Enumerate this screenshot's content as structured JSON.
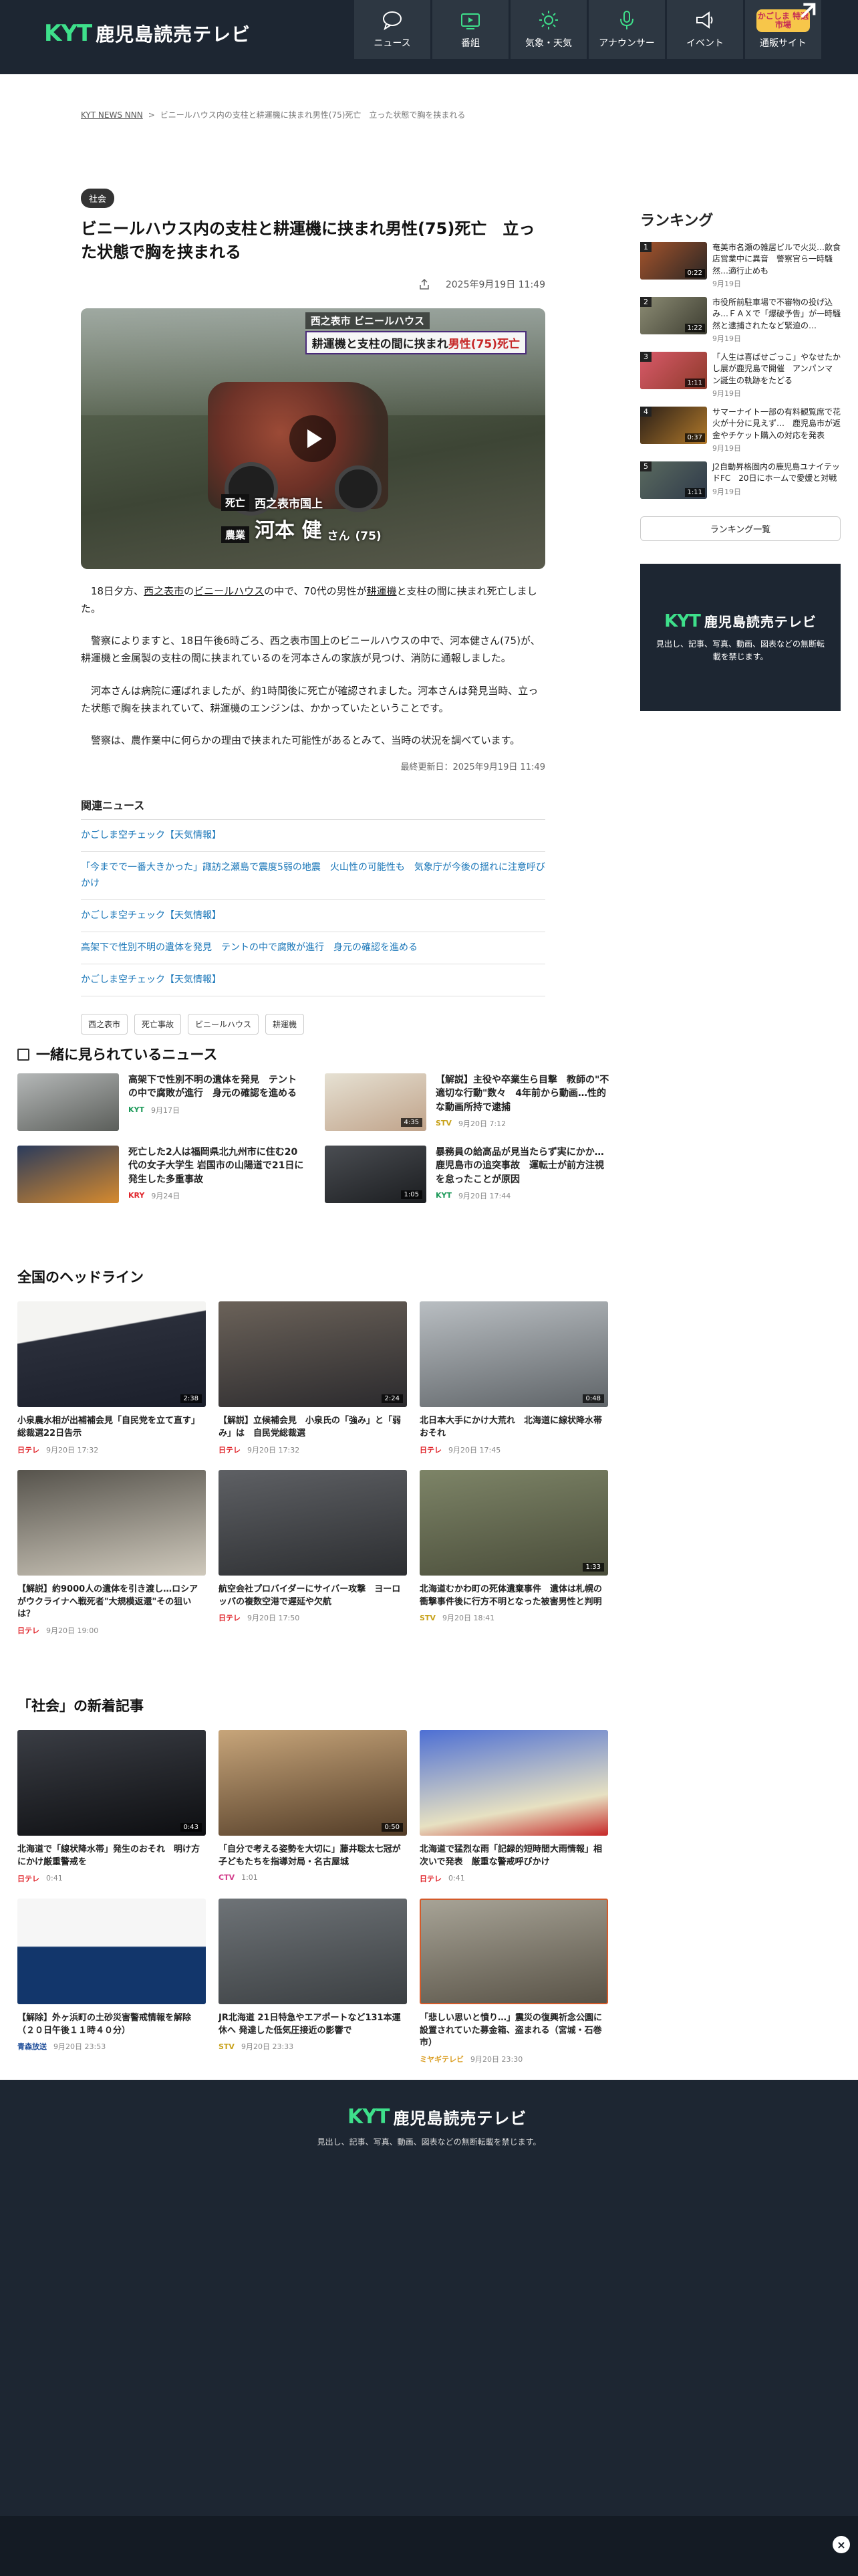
{
  "header": {
    "logo_kyt": "KYT",
    "logo_jp": "鹿児島読売テレビ",
    "nav": [
      {
        "label": "ニュース",
        "icon": "news-icon"
      },
      {
        "label": "番組",
        "icon": "tv-icon"
      },
      {
        "label": "気象・天気",
        "icon": "sun-icon"
      },
      {
        "label": "アナウンサー",
        "icon": "microphone-icon"
      },
      {
        "label": "イベント",
        "icon": "megaphone-icon"
      },
      {
        "label": "通販サイト",
        "badge": "かごしま 特選市場",
        "icon": "external-link-icon"
      }
    ]
  },
  "breadcrumb": {
    "home": "KYT NEWS NNN",
    "separator": ">",
    "current": "ビニールハウス内の支柱と耕運機に挟まれ男性(75)死亡　立った状態で胸を挟まれる"
  },
  "article": {
    "category": "社会",
    "title": "ビニールハウス内の支柱と耕運機に挟まれ男性(75)死亡　立った状態で胸を挟まれる",
    "date": "2025年9月19日 11:49",
    "video": {
      "caption_top_line1": "西之表市 ビニールハウス",
      "caption_top_line2_pre": "耕運機と支柱の間に挟まれ",
      "caption_top_line2_red": "男性(75)死亡",
      "chip_dead": "死亡",
      "place": "西之表市国上",
      "chip_job": "農業",
      "person": "河本 健",
      "honorific": "さん",
      "age": "(75)"
    },
    "paragraphs": [
      {
        "pre": "　18日夕方、",
        "ul1": "西之表市",
        "mid1": "の",
        "ul2": "ビニールハウス",
        "mid2": "の中で、70代の男性が",
        "ul3": "耕運機",
        "post": "と支柱の間に挟まれ死亡しました。"
      },
      {
        "text": "　警察によりますと、18日午後6時ごろ、西之表市国上のビニールハウスの中で、河本健さん(75)が、耕運機と金属製の支柱の間に挟まれているのを河本さんの家族が見つけ、消防に通報しました。"
      },
      {
        "text": "　河本さんは病院に運ばれましたが、約1時間後に死亡が確認されました。河本さんは発見当時、立った状態で胸を挟まれていて、耕運機のエンジンは、かかっていたということです。"
      },
      {
        "text": "　警察は、農作業中に何らかの理由で挟まれた可能性があるとみて、当時の状況を調べています。"
      }
    ],
    "updated": "最終更新日：2025年9月19日 11:49",
    "related_heading": "関連ニュース",
    "related": [
      "かごしま空チェック【天気情報】",
      "「今までで一番大きかった」諏訪之瀬島で震度5弱の地震　火山性の可能性も　気象庁が今後の揺れに注意呼びかけ",
      "かごしま空チェック【天気情報】",
      "高架下で性別不明の遺体を発見　テントの中で腐敗が進行　身元の確認を進める",
      "かごしま空チェック【天気情報】"
    ],
    "tags": [
      "西之表市",
      "死亡事故",
      "ビニールハウス",
      "耕運機"
    ]
  },
  "ranking": {
    "heading": "ランキング",
    "items": [
      {
        "num": "1",
        "dur": "0:22",
        "title": "奄美市名瀬の雑居ビルで火災…飲食店営業中に異音　警察官ら一時騒然…適行止めも",
        "date": "9月19日"
      },
      {
        "num": "2",
        "dur": "1:22",
        "title": "市役所前駐車場で不審物の投げ込み…ＦＡＸで「爆破予告」が一時騒然と逮捕されたなど緊迫の…",
        "date": "9月19日"
      },
      {
        "num": "3",
        "dur": "1:11",
        "title": "「人生は喜ばせごっこ」やなせたかし展が鹿児島で開催　アンパンマン誕生の軌跡をたどる",
        "date": "9月19日"
      },
      {
        "num": "4",
        "dur": "0:37",
        "title": "サマーナイト一部の有料観覧席で花火が十分に見えず…　鹿児島市が返金やチケット購入の対応を発表",
        "date": "9月19日"
      },
      {
        "num": "5",
        "dur": "1:11",
        "title": "J2自動昇格圏内の鹿児島ユナイテッドFC　20日にホームで愛媛と対戦",
        "date": "9月19日"
      }
    ],
    "more": "ランキング一覧",
    "banner_note": "見出し、記事、写真、動画、図表などの無断転載を禁じます。"
  },
  "also_watched": {
    "heading": "一緒に見られているニュース",
    "items": [
      {
        "title": "高架下で性別不明の遺体を発見　テントの中で腐敗が進行　身元の確認を進める",
        "src": "KYT",
        "date": "9月17日",
        "dur": ""
      },
      {
        "title": "【解説】主役や卒業生ら目撃　教師の\"不適切な行動\"数々　4年前から動画…性的な動画所持で逮捕",
        "src": "STV",
        "date": "9月20日 7:12",
        "dur": "4:35"
      },
      {
        "title": "死亡した2人は福岡県北九州市に住む20代の女子大学生 岩国市の山陽道で21日に発生した多重事故",
        "src": "KRY",
        "date": "9月24日",
        "dur": ""
      },
      {
        "title": "暴務員の給高品が見当たらず実にかか…鹿児島市の追突事故　運転士が前方注視を怠ったことが原因",
        "src": "KYT",
        "date": "9月20日 17:44",
        "dur": "1:05"
      }
    ]
  },
  "national": {
    "heading": "全国のヘッドライン",
    "items": [
      {
        "title": "小泉農水相が出補補会見「自民党を立て直す」総裁選22日告示",
        "src": "日テレ",
        "date": "9月20日 17:32",
        "dur": "2:38"
      },
      {
        "title": "【解説】立候補会見　小泉氏の「強み」と「弱み」は　自民党総裁選",
        "src": "日テレ",
        "date": "9月20日 17:32",
        "dur": "2:24"
      },
      {
        "title": "北日本大手にかけ大荒れ　北海道に線状降水帯おそれ",
        "src": "日テレ",
        "date": "9月20日 17:45",
        "dur": "0:48"
      },
      {
        "title": "【解説】約9000人の遺体を引き渡し…ロシアがウクライナへ戦死者\"大規模返還\"その狙いは？",
        "src": "日テレ",
        "date": "9月20日 19:00",
        "dur": ""
      },
      {
        "title": "航空会社プロバイダーにサイバー攻撃　ヨーロッパの複数空港で遅延や欠航",
        "src": "日テレ",
        "date": "9月20日 17:50",
        "dur": ""
      },
      {
        "title": "北海道むかわ町の死体遺棄事件　遺体は札幌の衝撃事件後に行方不明となった被害男性と判明",
        "src": "STV",
        "date": "9月20日 18:41",
        "dur": "1:33"
      }
    ]
  },
  "society": {
    "heading": "「社会」の新着記事",
    "items": [
      {
        "title": "北海道で「線状降水帯」発生のおそれ　明け方にかけ厳重警戒を",
        "src": "日テレ",
        "date": "0:41",
        "dur": "0:43"
      },
      {
        "title": "「自分で考える姿勢を大切に」藤井聡太七冠が子どもたちを指導対局・名古屋城",
        "src": "CTV",
        "date": "1:01",
        "dur": "0:50"
      },
      {
        "title": "北海道で猛烈な雨「記録的短時間大雨情報」相次いで発表　厳重な警戒呼びかけ",
        "src": "日テレ",
        "date": "0:41",
        "dur": ""
      },
      {
        "title": "【解除】外ヶ浜町の土砂災害警戒情報を解除（２０日午後１１時４０分）",
        "src": "青森放送",
        "date": "9月20日 23:53",
        "dur": ""
      },
      {
        "title": "JR北海道 21日特急やエアポートなど131本運休へ 発達した低気圧接近の影響で",
        "src": "STV",
        "date": "9月20日 23:33",
        "dur": ""
      },
      {
        "title": "「悲しい思いと憤り…」震災の復興祈念公園に設置されていた募金箱、盗まれる（宮城・石巻市）",
        "src": "ミヤギテレビ",
        "date": "9月20日 23:30",
        "dur": ""
      }
    ]
  },
  "footer": {
    "note": "見出し、記事、写真、動画、図表などの無断転載を禁じます。",
    "close": "×"
  },
  "colors": {
    "header_bg": "#1d2632",
    "brand_green": "#3ee08b",
    "link_blue": "#1976b8",
    "ntv_red": "#e0252b"
  }
}
